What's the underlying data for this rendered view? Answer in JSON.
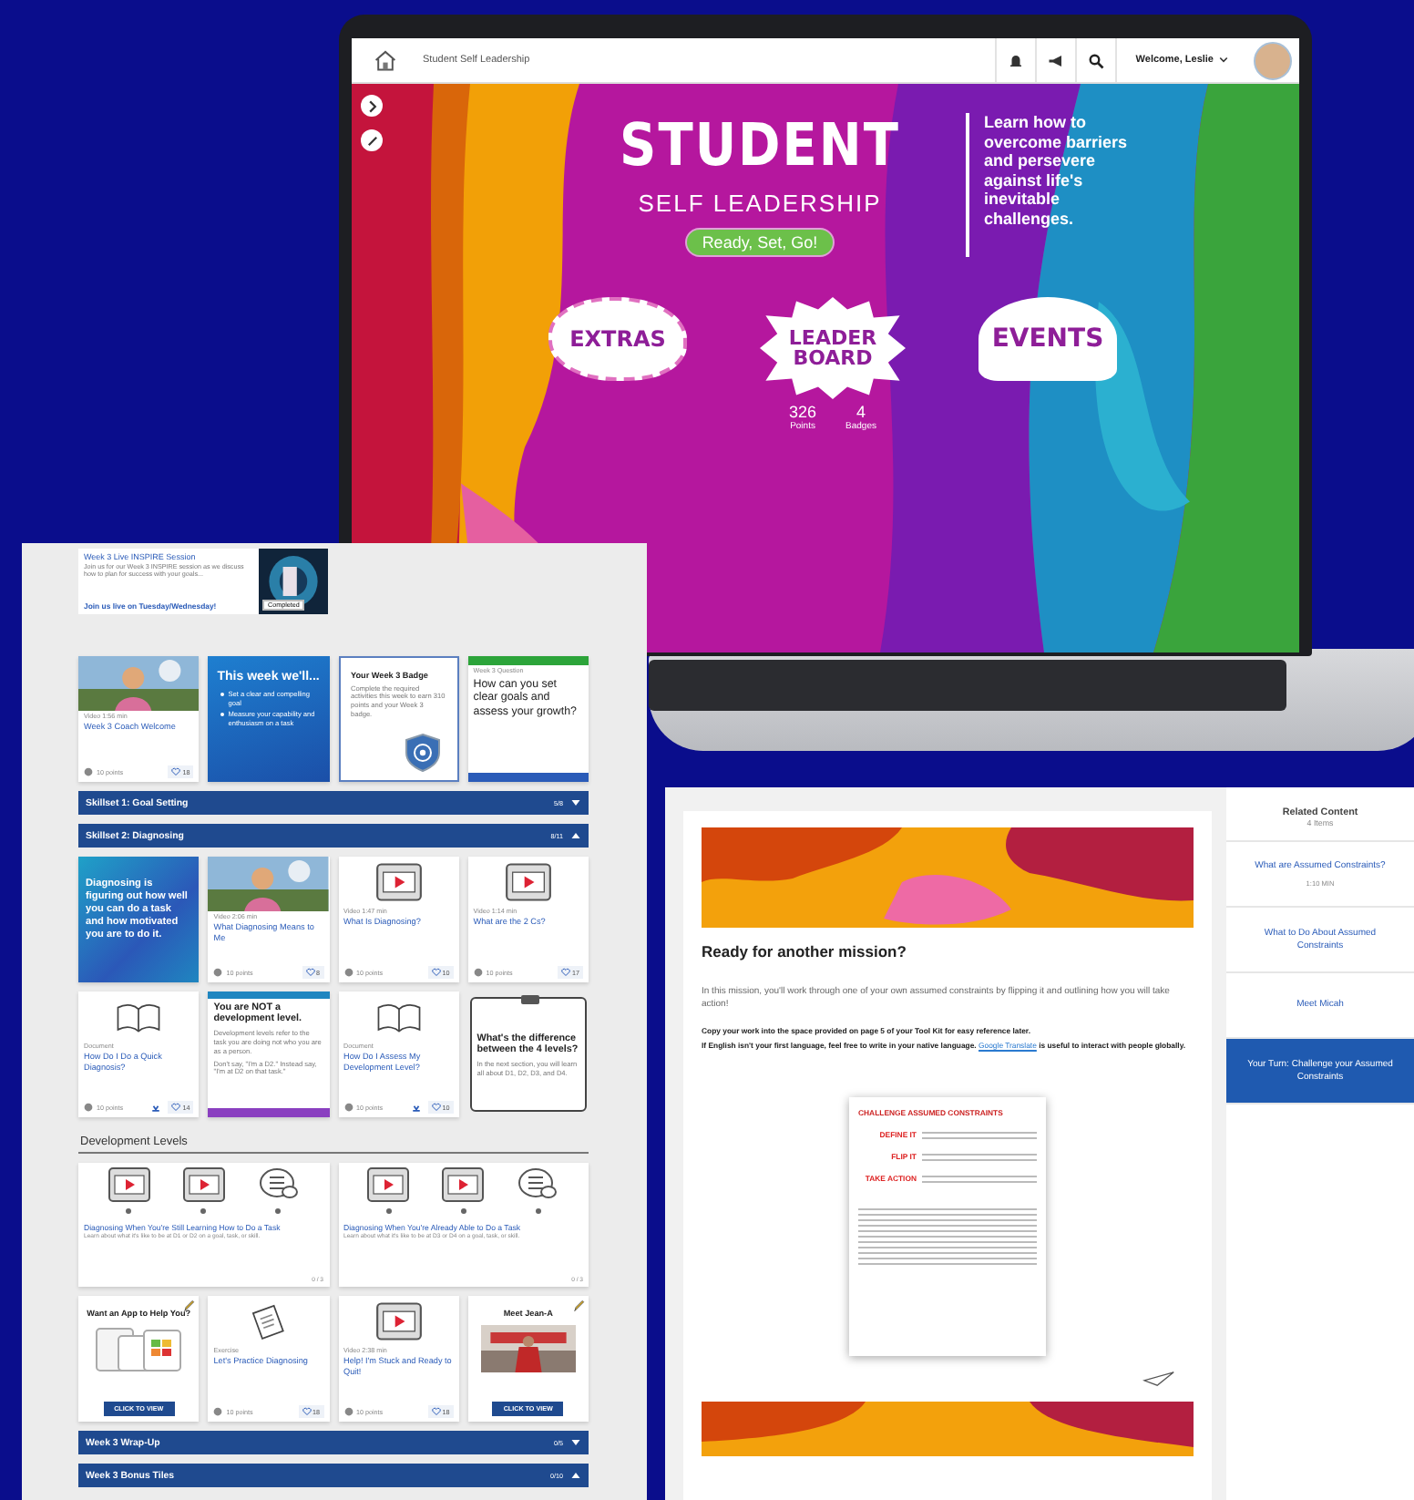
{
  "laptop": {
    "header": {
      "title": "Student Self Leadership",
      "welcome": "Welcome, Leslie"
    },
    "hero": {
      "title": "STUDENT",
      "subtitle": "SELF LEADERSHIP",
      "button": "Ready, Set, Go!",
      "tagline": "Learn how to overcome barriers and persevere against life's inevitable challenges.",
      "tiles": [
        {
          "kind": "extras",
          "label": "EXTRAS"
        },
        {
          "kind": "leaderboard",
          "label": "LEADER BOARD"
        },
        {
          "kind": "events",
          "label": "EVENTS"
        }
      ],
      "stats": [
        {
          "value": "326",
          "label": "Points"
        },
        {
          "value": "4",
          "label": "Badges"
        }
      ]
    }
  },
  "course": {
    "blocks": [
      {
        "kind": "live",
        "title": "Week 3 Live INSPIRE Session",
        "text": "Join us for our Week 3 INSPIRE session as we discuss how to plan for success with your goals...",
        "link": "Join us live on Tuesday/Wednesday!",
        "status": "Completed"
      },
      {
        "kind": "tiles",
        "tiles": [
          {
            "kind": "photo_video",
            "meta": "Video 1:56 min",
            "title": "Week 3 Coach Welcome",
            "points": "10 points",
            "likes": "18"
          },
          {
            "kind": "bullets",
            "title": "This week we'll...",
            "items": [
              "Set a clear and compelling goal",
              "Measure your capability and enthusiasm on a task"
            ]
          },
          {
            "kind": "badge",
            "title": "Your Week 3 Badge",
            "text": "Complete the required activities this week to earn 310 points and your Week 3 badge."
          },
          {
            "kind": "question",
            "meta": "Week 3 Question",
            "title": "How can you set clear goals and assess your growth?"
          }
        ]
      },
      {
        "kind": "section",
        "title": "Skillset 1: Goal Setting",
        "progress": "5/8",
        "expanded": false
      },
      {
        "kind": "section",
        "title": "Skillset 2: Diagnosing",
        "progress": "8/11",
        "expanded": true
      },
      {
        "kind": "tiles",
        "tiles": [
          {
            "kind": "quote",
            "text": "Diagnosing is figuring out how well you can do a task and how motivated you are to do it."
          },
          {
            "kind": "photo_video",
            "meta": "Video 2:06 min",
            "title": "What Diagnosing Means to Me",
            "points": "10 points",
            "likes": "8"
          },
          {
            "kind": "video",
            "meta": "Video 1:47 min",
            "title": "What Is Diagnosing?",
            "points": "10 points",
            "likes": "10"
          },
          {
            "kind": "video",
            "meta": "Video 1:14 min",
            "title": "What are the 2 Cs?",
            "points": "10 points",
            "likes": "17"
          }
        ]
      },
      {
        "kind": "tiles",
        "tiles": [
          {
            "kind": "document",
            "meta": "Document",
            "title": "How Do I Do a Quick Diagnosis?",
            "points": "10 points",
            "likes": "14"
          },
          {
            "kind": "notice",
            "title": "You are NOT a development level.",
            "text": "Development levels refer to the task you are doing not who you are as a person.",
            "text2": "Don't say, \"I'm a D2.\" Instead say, \"I'm at D2 on that task.\""
          },
          {
            "kind": "document",
            "meta": "Document",
            "title": "How Do I Assess My Development Level?",
            "points": "10 points",
            "likes": "10"
          },
          {
            "kind": "note",
            "title": "What's the difference between the 4 levels?",
            "text": "In the next section, you will learn all about D1, D2, D3, and D4."
          }
        ]
      },
      {
        "kind": "heading",
        "title": "Development Levels"
      },
      {
        "kind": "levels",
        "cards": [
          {
            "icons": [
              {
                "kind": "film"
              },
              {
                "kind": "film"
              },
              {
                "kind": "chat"
              }
            ],
            "title": "Diagnosing When You're Still Learning How to Do a Task",
            "text": "Learn about what it's like to be at D1 or D2 on a goal, task, or skill.",
            "count": "0 / 3"
          },
          {
            "icons": [
              {
                "kind": "film"
              },
              {
                "kind": "film"
              },
              {
                "kind": "chat"
              }
            ],
            "title": "Diagnosing When You're Already Able to Do a Task",
            "text": "Learn about what it's like to be at D3 or D4 on a goal, task, or skill.",
            "count": "0 / 3"
          }
        ]
      },
      {
        "kind": "tiles",
        "tiles": [
          {
            "kind": "app",
            "title": "Want an App to Help You?",
            "button": "CLICK TO VIEW"
          },
          {
            "kind": "practice",
            "meta": "Exercise",
            "title": "Let's Practice Diagnosing",
            "points": "10 points",
            "likes": "18"
          },
          {
            "kind": "video",
            "meta": "Video 2:38 min",
            "title": "Help! I'm Stuck and Ready to Quit!",
            "points": "10 points",
            "likes": "18"
          },
          {
            "kind": "meet",
            "title": "Meet Jean-A",
            "button": "CLICK TO VIEW"
          }
        ]
      },
      {
        "kind": "section",
        "title": "Week 3 Wrap-Up",
        "progress": "0/5",
        "expanded": false
      },
      {
        "kind": "section",
        "title": "Week 3 Bonus Tiles",
        "progress": "0/10",
        "expanded": true
      }
    ]
  },
  "mission": {
    "heading": "Ready for another mission?",
    "intro": "In this mission, you'll work through one of your own assumed constraints by flipping it and outlining how you will take action!",
    "instruction": "Copy your work into the space provided on page 5 of your Tool Kit for easy reference later.",
    "language_note": "If English isn't your first language, feel free to write in your native language.",
    "link": "Google Translate",
    "language_note_end": "is useful to interact with people globally.",
    "worksheet": {
      "title": "CHALLENGE ASSUMED CONSTRAINTS",
      "steps": [
        "DEFINE IT",
        "FLIP IT",
        "TAKE ACTION"
      ]
    },
    "related": {
      "title": "Related Content",
      "count": "4 Items",
      "items": [
        {
          "title": "What are Assumed Constraints?",
          "meta": "1:10 MIN",
          "selected": false
        },
        {
          "title": "What to Do About Assumed Constraints",
          "selected": false
        },
        {
          "title": "Meet Micah",
          "selected": false
        },
        {
          "title": "Your Turn: Challenge your Assumed Constraints",
          "selected": true
        }
      ]
    }
  }
}
